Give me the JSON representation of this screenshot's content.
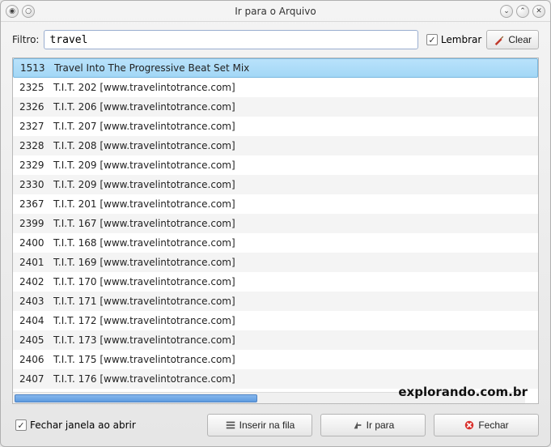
{
  "window": {
    "title": "Ir para o Arquivo"
  },
  "filter": {
    "label": "Filtro:",
    "value": "travel"
  },
  "remember": {
    "label": "Lembrar",
    "checked": true
  },
  "clear_button": "Clear",
  "list": {
    "selected_index": 0,
    "rows": [
      {
        "id": "1513",
        "title": "Travel Into The Progressive Beat Set Mix"
      },
      {
        "id": "2325",
        "title": "T.I.T. 202 [www.travelintotrance.com]"
      },
      {
        "id": "2326",
        "title": "T.I.T. 206 [www.travelintotrance.com]"
      },
      {
        "id": "2327",
        "title": "T.I.T. 207 [www.travelintotrance.com]"
      },
      {
        "id": "2328",
        "title": "T.I.T. 208 [www.travelintotrance.com]"
      },
      {
        "id": "2329",
        "title": "T.I.T. 209 [www.travelintotrance.com]"
      },
      {
        "id": "2330",
        "title": "T.I.T. 209 [www.travelintotrance.com]"
      },
      {
        "id": "2367",
        "title": "T.I.T. 201 [www.travelintotrance.com]"
      },
      {
        "id": "2399",
        "title": "T.I.T. 167 [www.travelintotrance.com]"
      },
      {
        "id": "2400",
        "title": "T.I.T. 168 [www.travelintotrance.com]"
      },
      {
        "id": "2401",
        "title": "T.I.T. 169 [www.travelintotrance.com]"
      },
      {
        "id": "2402",
        "title": "T.I.T. 170 [www.travelintotrance.com]"
      },
      {
        "id": "2403",
        "title": "T.I.T. 171 [www.travelintotrance.com]"
      },
      {
        "id": "2404",
        "title": "T.I.T. 172 [www.travelintotrance.com]"
      },
      {
        "id": "2405",
        "title": "T.I.T. 173 [www.travelintotrance.com]"
      },
      {
        "id": "2406",
        "title": "T.I.T. 175 [www.travelintotrance.com]"
      },
      {
        "id": "2407",
        "title": "T.I.T. 176 [www.travelintotrance.com]"
      }
    ]
  },
  "footer": {
    "close_on_open": {
      "label": "Fechar janela ao abrir",
      "checked": true
    },
    "queue_button": "Inserir na fila",
    "go_button": "Ir para",
    "close_button": "Fechar"
  },
  "watermark": "explorando.com.br"
}
